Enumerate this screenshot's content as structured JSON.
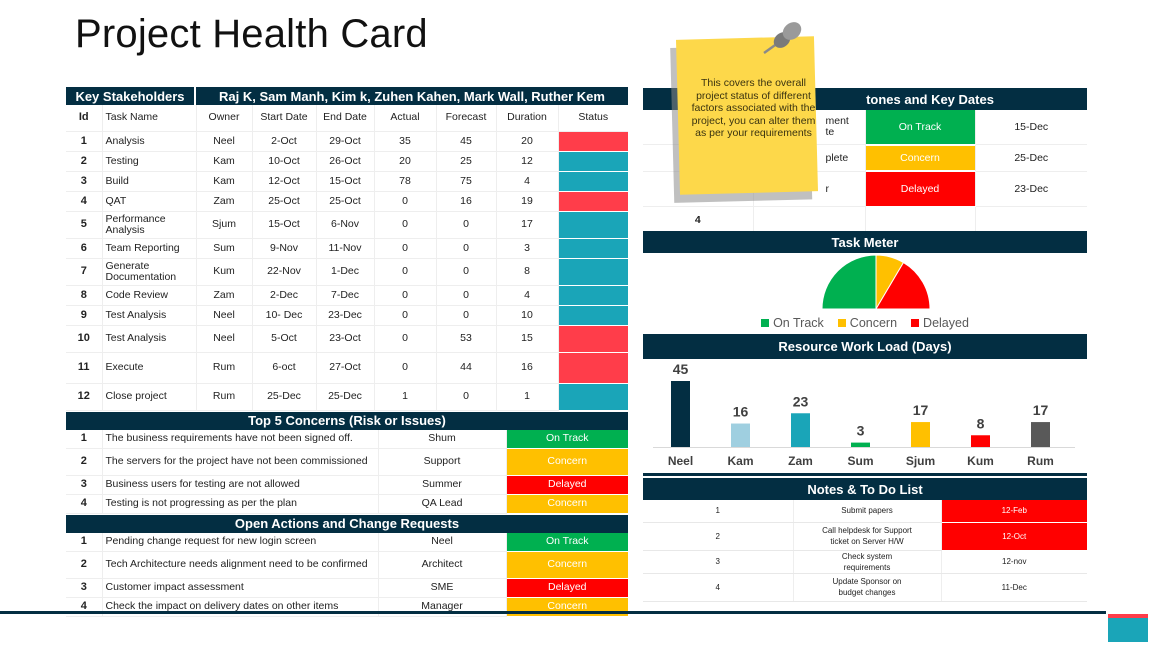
{
  "title": "Project Health Card",
  "colors": {
    "header": "#032e42",
    "on_track": "#00b050",
    "concern": "#ffc000",
    "delayed": "#ff0000",
    "red_status": "#ff3d4a",
    "teal_status": "#1aa5b8",
    "note": "#fdd84a"
  },
  "stakeholders": {
    "label": "Key Stakeholders",
    "value": "Raj K, Sam Manh, Kim k, Zuhen Kahen, Mark Wall, Ruther Kem"
  },
  "tasks": {
    "headers": [
      "Id",
      "Task Name",
      "Owner",
      "Start Date",
      "End Date",
      "Actual",
      "Forecast",
      "Duration",
      "Status"
    ],
    "rows": [
      {
        "id": "1",
        "name": "Analysis",
        "owner": "Neel",
        "start": "2-Oct",
        "end": "29-Oct",
        "actual": "35",
        "forecast": "45",
        "duration": "20",
        "status": "red"
      },
      {
        "id": "2",
        "name": "Testing",
        "owner": "Kam",
        "start": "10-Oct",
        "end": "26-Oct",
        "actual": "20",
        "forecast": "25",
        "duration": "12",
        "status": "teal"
      },
      {
        "id": "3",
        "name": "Build",
        "owner": "Kam",
        "start": "12-Oct",
        "end": "15-Oct",
        "actual": "78",
        "forecast": "75",
        "duration": "4",
        "status": "teal"
      },
      {
        "id": "4",
        "name": "QAT",
        "owner": "Zam",
        "start": "25-Oct",
        "end": "25-Oct",
        "actual": "0",
        "forecast": "16",
        "duration": "19",
        "status": "red"
      },
      {
        "id": "5",
        "name": "Performance Analysis",
        "owner": "Sjum",
        "start": "15-Oct",
        "end": "6-Nov",
        "actual": "0",
        "forecast": "0",
        "duration": "17",
        "status": "teal"
      },
      {
        "id": "6",
        "name": "Team Reporting",
        "owner": "Sum",
        "start": "9-Nov",
        "end": "11-Nov",
        "actual": "0",
        "forecast": "0",
        "duration": "3",
        "status": "teal"
      },
      {
        "id": "7",
        "name": "Generate Documentation",
        "owner": "Kum",
        "start": "22-Nov",
        "end": "1-Dec",
        "actual": "0",
        "forecast": "0",
        "duration": "8",
        "status": "teal"
      },
      {
        "id": "8",
        "name": "Code Review",
        "owner": "Zam",
        "start": "2-Dec",
        "end": "7-Dec",
        "actual": "0",
        "forecast": "0",
        "duration": "4",
        "status": "teal"
      },
      {
        "id": "9",
        "name": "Test Analysis",
        "owner": "Neel",
        "start": "10- Dec",
        "end": "23-Dec",
        "actual": "0",
        "forecast": "0",
        "duration": "10",
        "status": "teal"
      },
      {
        "id": "10",
        "name": "Test Analysis",
        "owner": "Neel",
        "start": "5-Oct",
        "end": "23-Oct",
        "actual": "0",
        "forecast": "53",
        "duration": "15",
        "status": "red"
      },
      {
        "id": "11",
        "name": "Execute",
        "owner": "Rum",
        "start": "6-oct",
        "end": "27-Oct",
        "actual": "0",
        "forecast": "44",
        "duration": "16",
        "status": "red"
      },
      {
        "id": "12",
        "name": "Close project",
        "owner": "Rum",
        "start": "25-Dec",
        "end": "25-Dec",
        "actual": "1",
        "forecast": "0",
        "duration": "1",
        "status": "teal"
      }
    ]
  },
  "concerns": {
    "title": "Top 5 Concerns (Risk or Issues)",
    "rows": [
      {
        "id": "1",
        "text": "The business requirements have not been signed off.",
        "owner": "Shum",
        "status": "On Track",
        "kind": "on_track"
      },
      {
        "id": "2",
        "text": "The servers for the project have not been commissioned",
        "owner": "Support",
        "status": "Concern",
        "kind": "concern"
      },
      {
        "id": "3",
        "text": "Business users for testing are not allowed",
        "owner": "Summer",
        "status": "Delayed",
        "kind": "delayed"
      },
      {
        "id": "4",
        "text": "Testing is not progressing as per the plan",
        "owner": "QA Lead",
        "status": "Concern",
        "kind": "concern"
      }
    ]
  },
  "actions": {
    "title": "Open Actions and Change Requests",
    "rows": [
      {
        "id": "1",
        "text": "Pending change request for new login screen",
        "owner": "Neel",
        "status": "On Track",
        "kind": "on_track"
      },
      {
        "id": "2",
        "text": "Tech Architecture needs alignment need to be confirmed",
        "owner": "Architect",
        "status": "Concern",
        "kind": "concern"
      },
      {
        "id": "3",
        "text": "Customer impact assessment",
        "owner": "SME",
        "status": "Delayed",
        "kind": "delayed"
      },
      {
        "id": "4",
        "text": "Check the impact on delivery dates on other items",
        "owner": "Manager",
        "status": "Concern",
        "kind": "concern"
      }
    ]
  },
  "milestones": {
    "title_visible": "tones and Key Dates",
    "rows": [
      {
        "id": "",
        "name_visible": "ment\nte",
        "status": "On Track",
        "kind": "on_track",
        "date": "15-Dec"
      },
      {
        "id": "",
        "name_visible": "plete",
        "status": "Concern",
        "kind": "concern",
        "date": "25-Dec"
      },
      {
        "id": "",
        "name_visible": "r",
        "status": "Delayed",
        "kind": "delayed",
        "date": "23-Dec"
      },
      {
        "id": "4",
        "name_visible": "",
        "status": "",
        "kind": "",
        "date": ""
      }
    ]
  },
  "sticky_note": {
    "text": "This covers the overall project status of different factors associated with the project, you can alter them as per your requirements"
  },
  "task_meter": {
    "title": "Task Meter"
  },
  "resource_workload": {
    "title": "Resource Work Load (Days)"
  },
  "notes": {
    "title": "Notes & To Do List",
    "rows": [
      {
        "id": "1",
        "text": "Submit papers",
        "date": "12-Feb",
        "highlight": true
      },
      {
        "id": "2",
        "text": "Call helpdesk for Support ticket on Server H/W",
        "date": "12-Oct",
        "highlight": true
      },
      {
        "id": "3",
        "text": "Check system requirements",
        "date": "12-nov",
        "highlight": false
      },
      {
        "id": "4",
        "text": "Update Sponsor on budget changes",
        "date": "11-Dec",
        "highlight": false
      }
    ]
  },
  "chart_data": [
    {
      "type": "pie",
      "title": "Task Meter",
      "variant": "half-pie",
      "categories": [
        "On Track",
        "Concern",
        "Delayed"
      ],
      "values": [
        50,
        17,
        33
      ],
      "colors": [
        "#00b050",
        "#ffc000",
        "#ff0000"
      ],
      "legend": "bottom"
    },
    {
      "type": "bar",
      "title": "Resource Work Load (Days)",
      "categories": [
        "Neel",
        "Kam",
        "Zam",
        "Sum",
        "Sjum",
        "Kum",
        "Rum"
      ],
      "values": [
        45,
        16,
        23,
        3,
        17,
        8,
        17
      ],
      "colors": [
        "#032e42",
        "#9fcfe0",
        "#1aa5b8",
        "#00b050",
        "#ffc000",
        "#ff0000",
        "#595959"
      ],
      "xlabel": "",
      "ylabel": "",
      "ylim": [
        0,
        45
      ],
      "data_labels": true,
      "grid": false
    }
  ]
}
